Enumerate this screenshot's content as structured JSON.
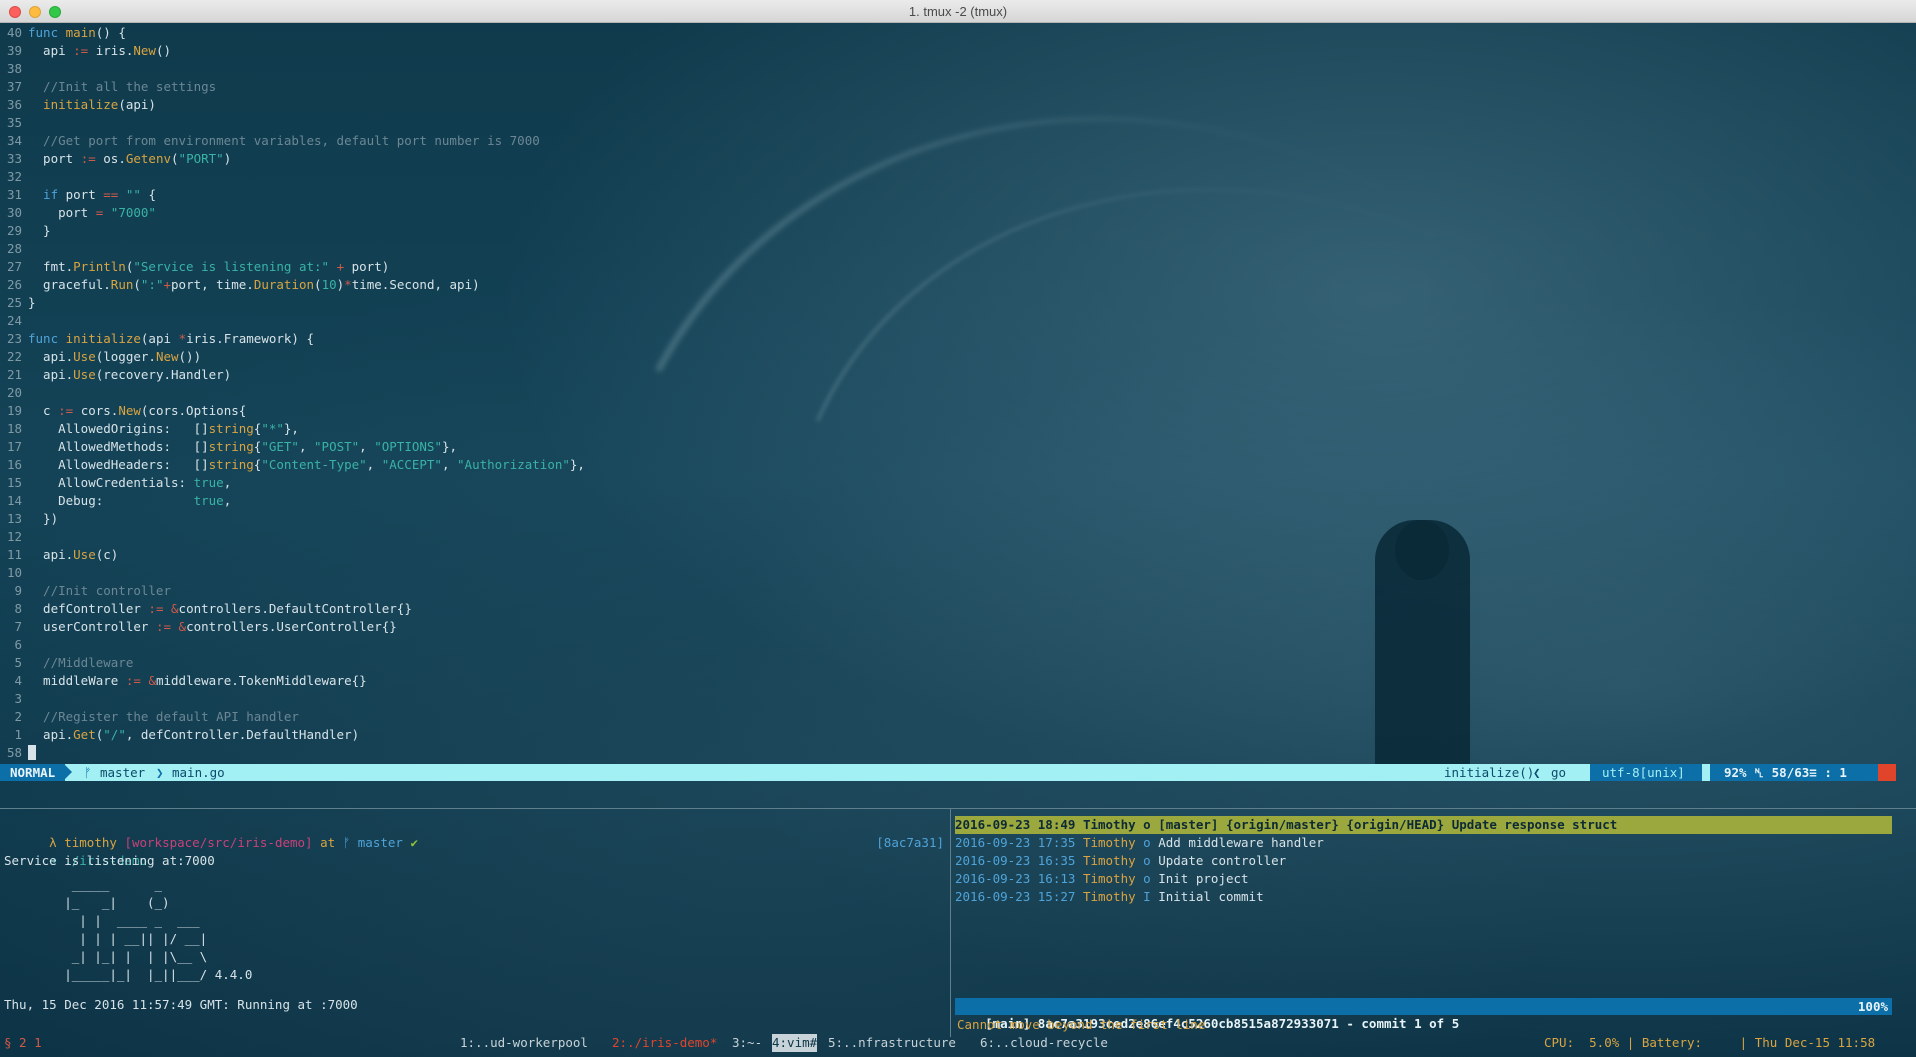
{
  "window": {
    "title": "1. tmux -2 (tmux)"
  },
  "editor": {
    "lines": [
      {
        "num": "40",
        "segments": [
          [
            "kw",
            "func "
          ],
          [
            "fn",
            "main"
          ],
          [
            "",
            "() {"
          ]
        ]
      },
      {
        "num": "39",
        "segments": [
          [
            "",
            "  api "
          ],
          [
            "op",
            ":="
          ],
          [
            "",
            " iris."
          ],
          [
            "fn",
            "New"
          ],
          [
            "",
            "()"
          ]
        ]
      },
      {
        "num": "38",
        "segments": [
          [
            "",
            ""
          ]
        ]
      },
      {
        "num": "37",
        "segments": [
          [
            "cm",
            "  //Init all the settings"
          ]
        ]
      },
      {
        "num": "36",
        "segments": [
          [
            "fn",
            "  initialize"
          ],
          [
            "",
            "(api)"
          ]
        ]
      },
      {
        "num": "35",
        "segments": [
          [
            "",
            ""
          ]
        ]
      },
      {
        "num": "34",
        "segments": [
          [
            "cm",
            "  //Get port from environment variables, default port number is 7000"
          ]
        ]
      },
      {
        "num": "33",
        "segments": [
          [
            "",
            "  port "
          ],
          [
            "op",
            ":="
          ],
          [
            "",
            " os."
          ],
          [
            "fn",
            "Getenv"
          ],
          [
            "",
            "("
          ],
          [
            "st",
            "\"PORT\""
          ],
          [
            "",
            ")"
          ]
        ]
      },
      {
        "num": "32",
        "segments": [
          [
            "",
            ""
          ]
        ]
      },
      {
        "num": "31",
        "segments": [
          [
            "kw",
            "  if"
          ],
          [
            "",
            " port "
          ],
          [
            "op",
            "=="
          ],
          [
            "",
            " "
          ],
          [
            "st",
            "\"\""
          ],
          [
            "",
            " {"
          ]
        ]
      },
      {
        "num": "30",
        "segments": [
          [
            "",
            "    port "
          ],
          [
            "op",
            "="
          ],
          [
            "",
            " "
          ],
          [
            "st",
            "\"7000\""
          ]
        ]
      },
      {
        "num": "29",
        "segments": [
          [
            "",
            "  }"
          ]
        ]
      },
      {
        "num": "28",
        "segments": [
          [
            "",
            ""
          ]
        ]
      },
      {
        "num": "27",
        "segments": [
          [
            "",
            "  fmt."
          ],
          [
            "fn",
            "Println"
          ],
          [
            "",
            "("
          ],
          [
            "st",
            "\"Service is listening at:\""
          ],
          [
            "",
            " "
          ],
          [
            "op",
            "+"
          ],
          [
            "",
            " port)"
          ]
        ]
      },
      {
        "num": "26",
        "segments": [
          [
            "",
            "  graceful."
          ],
          [
            "fn",
            "Run"
          ],
          [
            "",
            "("
          ],
          [
            "st",
            "\":\""
          ],
          [
            "op",
            "+"
          ],
          [
            "",
            "port, time."
          ],
          [
            "fn",
            "Duration"
          ],
          [
            "",
            "("
          ],
          [
            "st",
            "10"
          ],
          [
            "",
            ")"
          ],
          [
            "op",
            "*"
          ],
          [
            "",
            "time.Second, api)"
          ]
        ]
      },
      {
        "num": "25",
        "segments": [
          [
            "",
            "}"
          ]
        ]
      },
      {
        "num": "24",
        "segments": [
          [
            "",
            ""
          ]
        ]
      },
      {
        "num": "23",
        "segments": [
          [
            "kw",
            "func "
          ],
          [
            "fn",
            "initialize"
          ],
          [
            "",
            "(api "
          ],
          [
            "op",
            "*"
          ],
          [
            "",
            "iris.Framework) {"
          ]
        ]
      },
      {
        "num": "22",
        "segments": [
          [
            "",
            "  api."
          ],
          [
            "fn",
            "Use"
          ],
          [
            "",
            "(logger."
          ],
          [
            "fn",
            "New"
          ],
          [
            "",
            "())"
          ]
        ]
      },
      {
        "num": "21",
        "segments": [
          [
            "",
            "  api."
          ],
          [
            "fn",
            "Use"
          ],
          [
            "",
            "(recovery.Handler)"
          ]
        ]
      },
      {
        "num": "20",
        "segments": [
          [
            "",
            ""
          ]
        ]
      },
      {
        "num": "19",
        "segments": [
          [
            "",
            "  c "
          ],
          [
            "op",
            ":="
          ],
          [
            "",
            " cors."
          ],
          [
            "fn",
            "New"
          ],
          [
            "",
            "(cors.Options{"
          ]
        ]
      },
      {
        "num": "18",
        "segments": [
          [
            "",
            "    AllowedOrigins:   []"
          ],
          [
            "fn",
            "string"
          ],
          [
            "",
            "{"
          ],
          [
            "st",
            "\"*\""
          ],
          [
            "",
            "},"
          ]
        ]
      },
      {
        "num": "17",
        "segments": [
          [
            "",
            "    AllowedMethods:   []"
          ],
          [
            "fn",
            "string"
          ],
          [
            "",
            "{"
          ],
          [
            "st",
            "\"GET\""
          ],
          [
            "",
            ", "
          ],
          [
            "st",
            "\"POST\""
          ],
          [
            "",
            ", "
          ],
          [
            "st",
            "\"OPTIONS\""
          ],
          [
            "",
            "},"
          ]
        ]
      },
      {
        "num": "16",
        "segments": [
          [
            "",
            "    AllowedHeaders:   []"
          ],
          [
            "fn",
            "string"
          ],
          [
            "",
            "{"
          ],
          [
            "st",
            "\"Content-Type\""
          ],
          [
            "",
            ", "
          ],
          [
            "st",
            "\"ACCEPT\""
          ],
          [
            "",
            ", "
          ],
          [
            "st",
            "\"Authorization\""
          ],
          [
            "",
            "},"
          ]
        ]
      },
      {
        "num": "15",
        "segments": [
          [
            "",
            "    AllowCredentials: "
          ],
          [
            "st",
            "true"
          ],
          [
            "",
            ","
          ]
        ]
      },
      {
        "num": "14",
        "segments": [
          [
            "",
            "    Debug:            "
          ],
          [
            "st",
            "true"
          ],
          [
            "",
            ","
          ]
        ]
      },
      {
        "num": "13",
        "segments": [
          [
            "",
            "  })"
          ]
        ]
      },
      {
        "num": "12",
        "segments": [
          [
            "",
            ""
          ]
        ]
      },
      {
        "num": "11",
        "segments": [
          [
            "",
            "  api."
          ],
          [
            "fn",
            "Use"
          ],
          [
            "",
            "(c)"
          ]
        ]
      },
      {
        "num": "10",
        "segments": [
          [
            "",
            ""
          ]
        ]
      },
      {
        "num": "9",
        "segments": [
          [
            "cm",
            "  //Init controller"
          ]
        ]
      },
      {
        "num": "8",
        "segments": [
          [
            "",
            "  defController "
          ],
          [
            "op",
            ":="
          ],
          [
            "",
            " "
          ],
          [
            "op",
            "&"
          ],
          [
            "",
            "controllers.DefaultController{}"
          ]
        ]
      },
      {
        "num": "7",
        "segments": [
          [
            "",
            "  userController "
          ],
          [
            "op",
            ":="
          ],
          [
            "",
            " "
          ],
          [
            "op",
            "&"
          ],
          [
            "",
            "controllers.UserController{}"
          ]
        ]
      },
      {
        "num": "6",
        "segments": [
          [
            "",
            ""
          ]
        ]
      },
      {
        "num": "5",
        "segments": [
          [
            "cm",
            "  //Middleware"
          ]
        ]
      },
      {
        "num": "4",
        "segments": [
          [
            "",
            "  middleWare "
          ],
          [
            "op",
            ":="
          ],
          [
            "",
            " "
          ],
          [
            "op",
            "&"
          ],
          [
            "",
            "middleware.TokenMiddleware{}"
          ]
        ]
      },
      {
        "num": "3",
        "segments": [
          [
            "",
            ""
          ]
        ]
      },
      {
        "num": "2",
        "segments": [
          [
            "cm",
            "  //Register the default API handler"
          ]
        ]
      },
      {
        "num": "1",
        "segments": [
          [
            "",
            "  api."
          ],
          [
            "fn",
            "Get"
          ],
          [
            "",
            "("
          ],
          [
            "st",
            "\"/\""
          ],
          [
            "",
            ", defController.DefaultHandler)"
          ]
        ]
      },
      {
        "num": "58",
        "segments": [
          [
            "cursor",
            " "
          ]
        ]
      }
    ]
  },
  "statusline": {
    "mode": "NORMAL",
    "branch_icon": "ᚠ",
    "branch": "master",
    "separator": "❯",
    "file": "main.go",
    "function": "initialize()",
    "ft_separator": "❮",
    "filetype": "go",
    "encoding": "utf-8[unix]",
    "percent": "92%",
    "position_icon": "␤",
    "position": "58/63≡ :  1",
    "colors": {
      "bar": "#a2eff4",
      "mode_bg": "#0c6fa8",
      "end": "#e0452c"
    }
  },
  "terminal": {
    "prompt": {
      "lambda": "λ",
      "user": "timothy",
      "path": "[workspace/src/iris-demo]",
      "at": "at",
      "branch_icon": "ᚠ",
      "branch": "master",
      "check": "✔"
    },
    "command_arrow": "➜",
    "command": "./iris-demo",
    "sha": "[8ac7a31]",
    "output": "Service is listening at:7000",
    "ascii_art": [
      "         _____      _",
      "        |_   _|    (_)",
      "          | |  ____ _  ___",
      "          | | | __|| |/ __|",
      "         _| |_| |  | |\\__ \\",
      "        |_____|_|  |_||___/ 4.4.0"
    ],
    "footer": "Thu, 15 Dec 2016 11:57:49 GMT: Running at :7000"
  },
  "git": {
    "commits": [
      {
        "date": "2016-09-23 18:49",
        "author": "Timothy",
        "mark": "o",
        "refs": "[master] {origin/master} {origin/HEAD}",
        "message": "Update response struct",
        "selected": true
      },
      {
        "date": "2016-09-23 17:35",
        "author": "Timothy",
        "mark": "o",
        "refs": "",
        "message": "Add middleware handler",
        "selected": false
      },
      {
        "date": "2016-09-23 16:35",
        "author": "Timothy",
        "mark": "o",
        "refs": "",
        "message": "Update controller",
        "selected": false
      },
      {
        "date": "2016-09-23 16:13",
        "author": "Timothy",
        "mark": "o",
        "refs": "",
        "message": "Init project",
        "selected": false
      },
      {
        "date": "2016-09-23 15:27",
        "author": "Timothy",
        "mark": "I",
        "refs": "",
        "message": "Initial commit",
        "selected": false
      }
    ],
    "status": "[main] 8ac7a3193ced2e86ef4c5260cb8515a872933071 - commit 1 of 5",
    "status_percent": "100%",
    "message": "Cannot move beyond the first line"
  },
  "tmux": {
    "session": "§ 2 1",
    "windows": [
      {
        "label": "1:..ud-workerpool",
        "state": "normal"
      },
      {
        "label": "2:./iris-demo*",
        "state": "current"
      },
      {
        "label": "3:~-",
        "state": "normal"
      },
      {
        "label": "4:vim#",
        "state": "active"
      },
      {
        "label": "5:..nfrastructure",
        "state": "normal"
      },
      {
        "label": "6:..cloud-recycle",
        "state": "normal"
      }
    ],
    "right": "CPU:  5.0% | Battery:     | Thu Dec-15 11:58"
  }
}
